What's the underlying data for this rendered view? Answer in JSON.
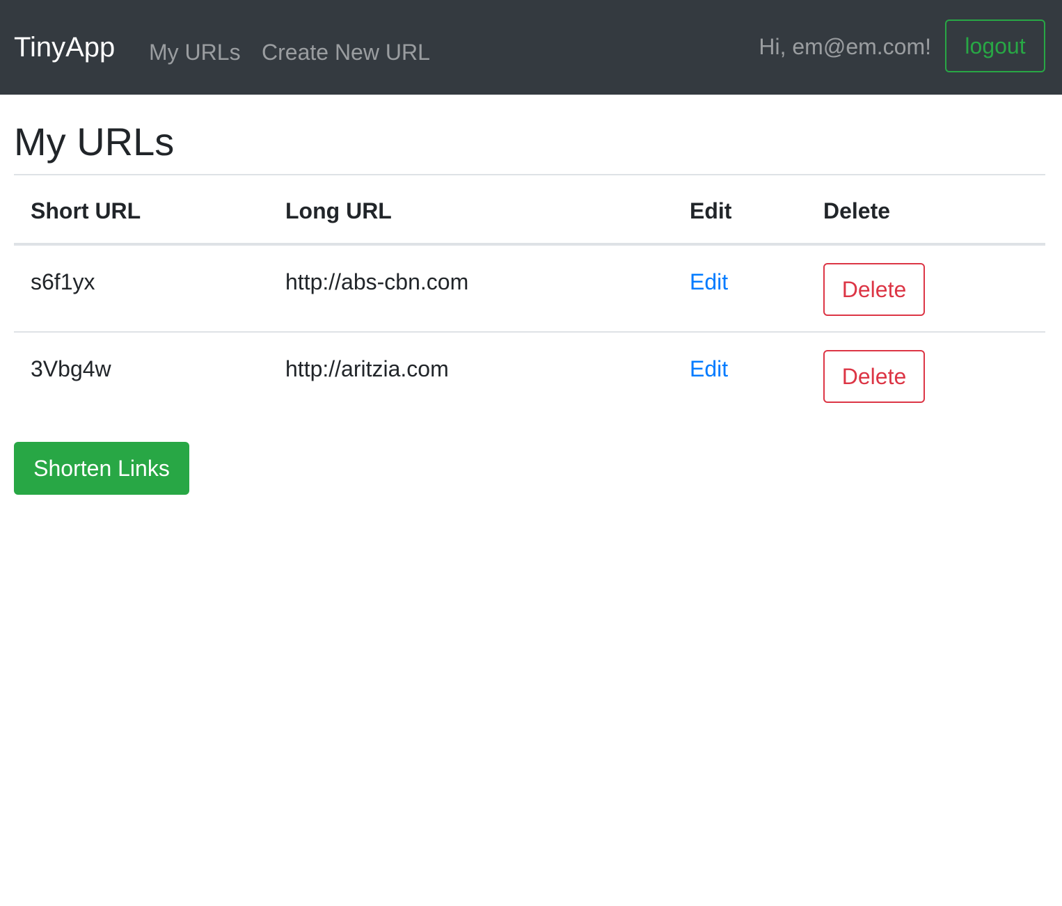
{
  "navbar": {
    "brand": "TinyApp",
    "links": [
      "My URLs",
      "Create New URL"
    ],
    "greeting": "Hi, em@em.com!",
    "logout_label": "logout"
  },
  "main": {
    "title": "My URLs",
    "table": {
      "headers": [
        "Short URL",
        "Long URL",
        "Edit",
        "Delete"
      ],
      "rows": [
        {
          "short": "s6f1yx",
          "long": "http://abs-cbn.com",
          "edit": "Edit",
          "delete": "Delete"
        },
        {
          "short": "3Vbg4w",
          "long": "http://aritzia.com",
          "edit": "Edit",
          "delete": "Delete"
        }
      ]
    },
    "shorten_label": "Shorten Links"
  },
  "colors": {
    "navbar_bg": "#343a40",
    "success": "#28a745",
    "danger": "#dc3545",
    "link": "#007bff"
  }
}
